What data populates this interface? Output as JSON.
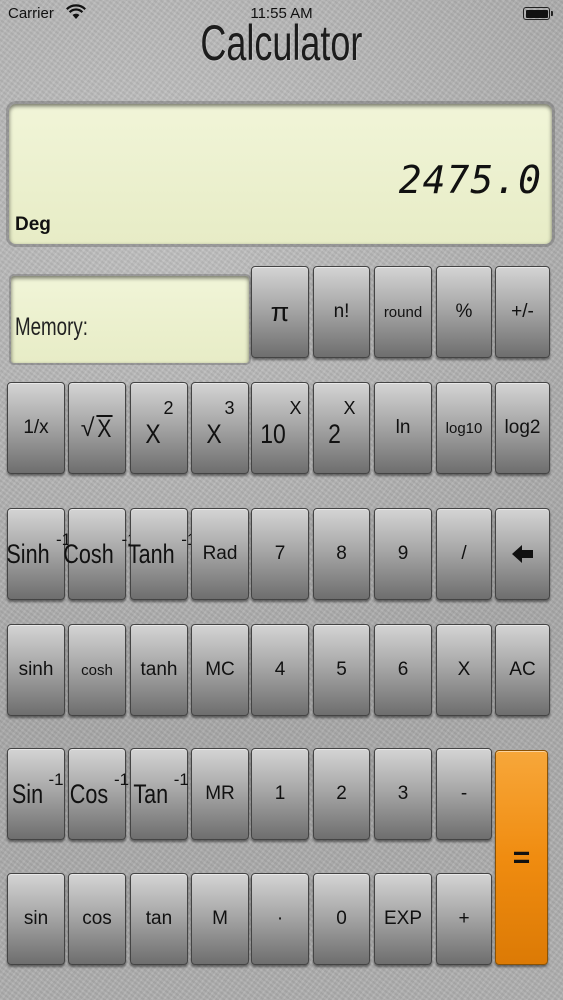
{
  "status_bar": {
    "carrier": "Carrier",
    "time": "11:55 AM"
  },
  "app": {
    "title": "Calculator"
  },
  "display": {
    "value": "2475.0",
    "angle_mode": "Deg"
  },
  "memory": {
    "label": "Memory:"
  },
  "keys": {
    "pi": "π",
    "fact": "n!",
    "round": "round",
    "percent": "%",
    "sign": "+/-",
    "recip": "1/x",
    "sqrt_sym": "√",
    "sqrt_var": "X",
    "sq_base": "X",
    "sq_exp": "2",
    "cube_base": "X",
    "cube_exp": "3",
    "ten_base": "10",
    "ten_exp": "X",
    "two_base": "2",
    "two_exp": "X",
    "ln": "ln",
    "log10": "log10",
    "log2": "log2",
    "asinh_base": "Sinh",
    "asinh_exp": "-1",
    "acosh_base": "Cosh",
    "acosh_exp": "-1",
    "atanh_base": "Tanh",
    "atanh_exp": "-1",
    "rad": "Rad",
    "n7": "7",
    "n8": "8",
    "n9": "9",
    "divide": "/",
    "sinh": "sinh",
    "cosh": "cosh",
    "tanh": "tanh",
    "mc": "MC",
    "n4": "4",
    "n5": "5",
    "n6": "6",
    "multiply": "X",
    "ac": "AC",
    "asin_base": "Sin",
    "asin_exp": "-1",
    "acos_base": "Cos",
    "acos_exp": "-1",
    "atan_base": "Tan",
    "atan_exp": "-1",
    "mr": "MR",
    "n1": "1",
    "n2": "2",
    "n3": "3",
    "minus": "-",
    "equals": "=",
    "sin": "sin",
    "cos": "cos",
    "tan": "tan",
    "m": "M",
    "dot": "·",
    "n0": "0",
    "exp": "EXP",
    "plus": "+"
  }
}
